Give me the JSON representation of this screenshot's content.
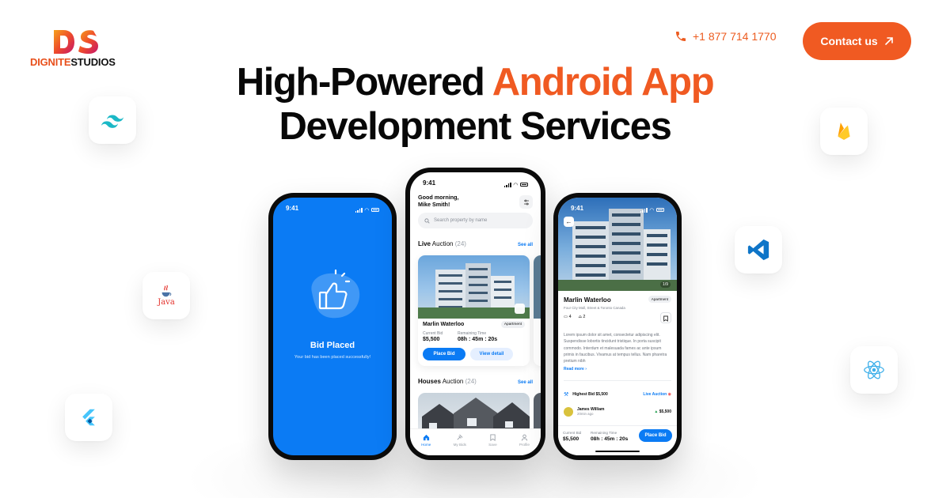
{
  "brand": {
    "mark": "DS",
    "name_a": "DIGNITE",
    "name_b": "STUDIOS",
    "colors": {
      "accent": "#f05a22",
      "blue": "#0b7bf4"
    }
  },
  "header": {
    "phone": "+1 877 714 1770",
    "contact_label": "Contact us"
  },
  "headline": {
    "line1_a": "High-Powered ",
    "line1_b": "Android App",
    "line2": "Development Services"
  },
  "tech_icons": [
    "tailwind-icon",
    "java-icon",
    "flutter-icon",
    "firebase-icon",
    "vscode-icon",
    "react-icon"
  ],
  "java_label": "Java",
  "phone1": {
    "time": "9:41",
    "title": "Bid Placed",
    "subtitle": "Your bid has been placed successfully!"
  },
  "phone2": {
    "time": "9:41",
    "greet1": "Good morning,",
    "greet2": "Mike Smith!",
    "search_placeholder": "Search property by name",
    "live_a": "Live",
    "live_b": " Auction",
    "live_count": "(24)",
    "see_all": "See all",
    "card": {
      "title": "Marlin Waterloo",
      "tag": "Apartment",
      "bid_label": "Current Bid",
      "bid_value": "$5,500",
      "time_label": "Remaining Time",
      "time_value": "08h : 45m : 20s",
      "place_bid": "Place Bid",
      "view_detail": "View detail"
    },
    "houses_a": "Houses",
    "houses_b": " Auction",
    "houses_count": "(24)",
    "see_all2": "See all",
    "tabs": [
      "Home",
      "My Bids",
      "Save",
      "Profile"
    ]
  },
  "phone3": {
    "time": "9:41",
    "pager": "1/9",
    "title": "Marlin Waterloo",
    "tag": "Apartment",
    "address": "Four City Mall, Street & Toronto Canada",
    "beds": "4",
    "baths": "2",
    "desc": "Lorem ipsum dolor sit amet, consectetur adipiscing elit. Suspendisse lobortis tincidunt tristique. In porta suscipit commodo. Interdum et malesuada fames ac ante ipsum primis in faucibus. Vivamus at tempus tellus. Nam pharetra pretium nibh",
    "read_more": "Read more",
    "highest_bid": "Highest Bid $5,500",
    "live_auction": "Live Auction",
    "bidder_name": "James William",
    "bidder_time": "20min ago",
    "bidder_amount": "$5,500",
    "cur_label": "Current Bid",
    "cur_value": "$5,500",
    "rem_label": "Remaining Time",
    "rem_value": "08h : 45m : 20s",
    "place_bid": "Place Bid"
  }
}
